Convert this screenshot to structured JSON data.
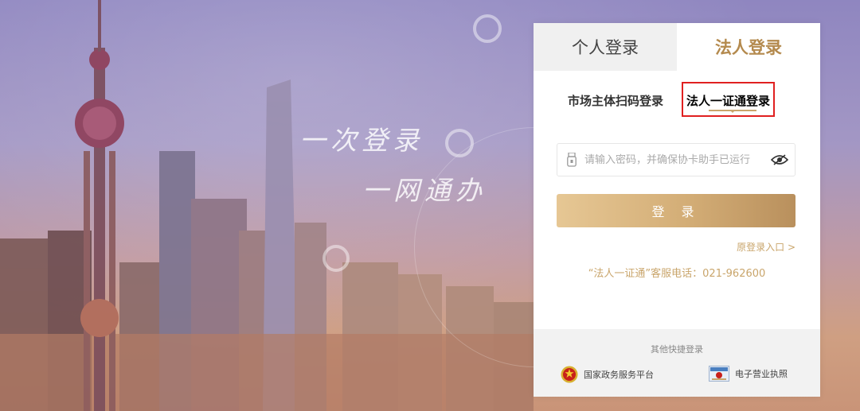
{
  "hero": {
    "slogan_line1": "一次登录",
    "slogan_line2": "一网通办"
  },
  "login": {
    "tabs": [
      {
        "label": "个人登录",
        "active": false
      },
      {
        "label": "法人登录",
        "active": true
      }
    ],
    "subtabs": [
      {
        "label": "市场主体扫码登录",
        "active": false
      },
      {
        "label": "法人一证通登录",
        "active": true
      }
    ],
    "password": {
      "placeholder": "请输入密码，并确保协卡助手已运行",
      "value": ""
    },
    "submit_label": "登 录",
    "old_entry_label": "原登录入口 >",
    "hotline": "“法人一证通”客服电话：021-962600",
    "other_title": "其他快捷登录",
    "quick_logins": [
      {
        "label": "国家政务服务平台",
        "icon": "national-emblem-icon"
      },
      {
        "label": "电子营业执照",
        "icon": "business-license-icon"
      }
    ]
  },
  "colors": {
    "accent_gold": "#c9a56b",
    "highlight_red": "#e02020",
    "tab_inactive_bg": "#f0f0f0"
  }
}
